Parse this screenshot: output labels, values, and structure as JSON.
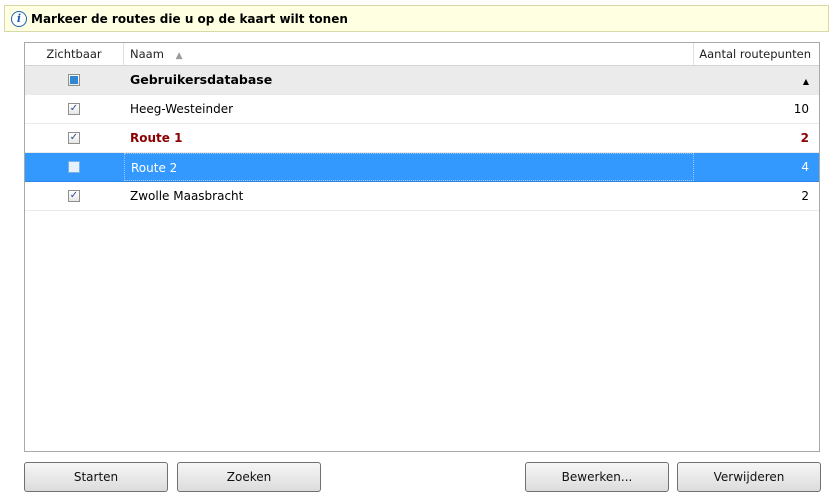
{
  "info": {
    "text": "Markeer de routes die u op de kaart wilt tonen",
    "icon": "info-icon"
  },
  "columns": {
    "visible": "Zichtbaar",
    "name": "Naam",
    "count": "Aantal routepunten",
    "sort_arrow": "▲"
  },
  "group": {
    "name": "Gebruikersdatabase",
    "collapse_arrow": "▲",
    "visibility": "partial"
  },
  "rows": [
    {
      "name": "Heeg-Westeinder",
      "count": "10",
      "checked": true,
      "selected": false,
      "highlight": false
    },
    {
      "name": "Route 1",
      "count": "2",
      "checked": true,
      "selected": false,
      "highlight": true
    },
    {
      "name": "Route 2",
      "count": "4",
      "checked": false,
      "selected": true,
      "highlight": false
    },
    {
      "name": "Zwolle Maasbracht",
      "count": "2",
      "checked": true,
      "selected": false,
      "highlight": false
    }
  ],
  "buttons": {
    "start": "Starten",
    "search": "Zoeken",
    "edit": "Bewerken...",
    "delete": "Verwijderen"
  },
  "colors": {
    "selection": "#3399ff",
    "highlight_text": "#8b0000",
    "info_background": "#ffffe1"
  }
}
